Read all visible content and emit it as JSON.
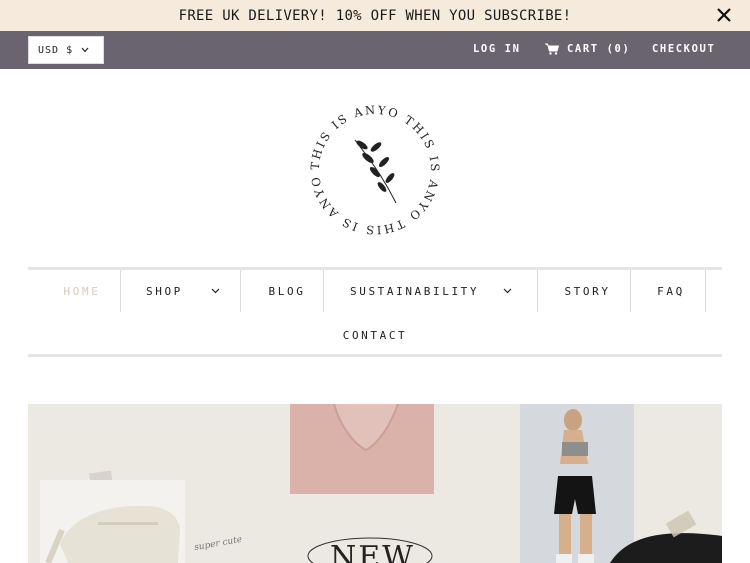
{
  "announcement": {
    "text": "FREE UK DELIVERY! 10% OFF WHEN YOU SUBSCRIBE!"
  },
  "topbar": {
    "currency": "USD $",
    "login": "LOG IN",
    "cart": "CART (0)",
    "checkout": "CHECKOUT"
  },
  "logo": {
    "ring_text": "THIS IS ANYO THIS IS ANYO THIS IS ANYO"
  },
  "nav": {
    "home": "HOME",
    "shop": "SHOP",
    "blog": "BLOG",
    "sustainability": "SUSTAINABILITY",
    "story": "STORY",
    "faq": "FAQ",
    "contact": "CONTACT"
  },
  "hero": {
    "script_text": "super cute",
    "headline": "NEW"
  },
  "colors": {
    "announce_bg": "#f6eadc",
    "topbar_bg": "#69646f",
    "nav_home_active": "#d9c9b8",
    "hero_bg": "#ece8e2"
  }
}
